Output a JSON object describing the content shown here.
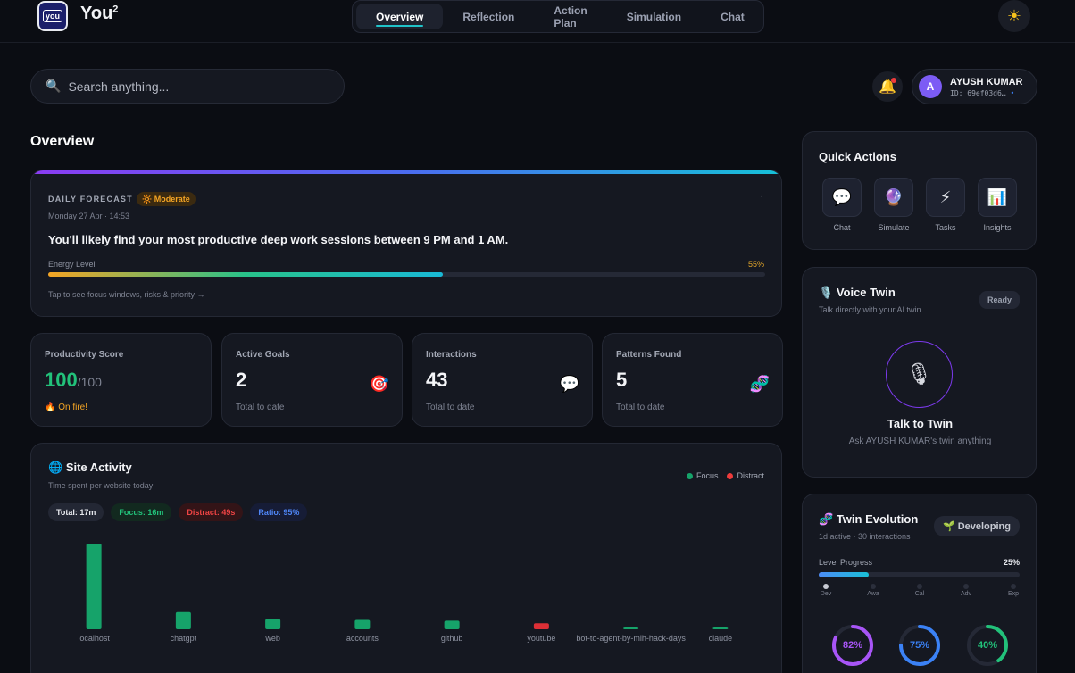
{
  "header": {
    "logo_text": "you",
    "brand_name": "You",
    "brand_sup": "2",
    "tabs": [
      {
        "label": "Overview",
        "active": true
      },
      {
        "label": "Reflection",
        "active": false
      },
      {
        "label": "Action Plan",
        "active": false
      },
      {
        "label": "Simulation",
        "active": false
      },
      {
        "label": "Chat",
        "active": false
      }
    ],
    "theme_icon": "sun-icon"
  },
  "search": {
    "placeholder": "Search anything..."
  },
  "user": {
    "initial": "A",
    "name": "AYUSH KUMAR",
    "id": "ID: 69ef03d6…",
    "status_dot": "•"
  },
  "page_title": "Overview",
  "forecast": {
    "label": "DAILY FORECAST",
    "badge": "🔆 Moderate",
    "date": "Monday 27 Apr · 14:53",
    "menu_dot": "·",
    "text": "You'll likely find your most productive deep work sessions between 9 PM and 1 AM.",
    "energy_label": "Energy Level",
    "energy_pct_label": "55%",
    "energy_value": 0.55,
    "hint": "Tap to see focus windows, risks & priority →"
  },
  "stats": [
    {
      "title": "Productivity Score",
      "value": "100",
      "suffix": "/100",
      "sub": "🔥 On fire!",
      "icon": ""
    },
    {
      "title": "Active Goals",
      "value": "2",
      "suffix": "",
      "sub": "Total to date",
      "icon": "🎯"
    },
    {
      "title": "Interactions",
      "value": "43",
      "suffix": "",
      "sub": "Total to date",
      "icon": "💬"
    },
    {
      "title": "Patterns Found",
      "value": "5",
      "suffix": "",
      "sub": "Total to date",
      "icon": "🧬"
    }
  ],
  "site_activity": {
    "icon": "🌐",
    "title": "Site Activity",
    "subtitle": "Time spent per website today",
    "legend_focus": "Focus",
    "legend_distract": "Distract",
    "pills": {
      "total": "Total: 17m",
      "focus": "Focus: 16m",
      "distract": "Distract: 49s",
      "ratio": "Ratio: 95%"
    }
  },
  "chart_data": {
    "type": "bar",
    "categories": [
      "localhost",
      "chatgpt",
      "web",
      "accounts",
      "github",
      "youtube",
      "bot-to-agent-by-mlh-hack-days",
      "claude"
    ],
    "values": [
      100,
      20,
      12,
      11,
      10,
      7,
      2,
      2
    ],
    "kinds": [
      "focus",
      "focus",
      "focus",
      "focus",
      "focus",
      "distract",
      "focus",
      "focus"
    ],
    "series": [
      {
        "name": "Focus"
      },
      {
        "name": "Distract"
      }
    ],
    "colors": {
      "focus": "#16a36a",
      "distract": "#dc2f36"
    },
    "legend": "top-right",
    "grid": false
  },
  "quick_actions": {
    "title": "Quick Actions",
    "items": [
      {
        "label": "Chat",
        "icon": "💬"
      },
      {
        "label": "Simulate",
        "icon": "🔮"
      },
      {
        "label": "Tasks",
        "icon": "⚡"
      },
      {
        "label": "Insights",
        "icon": "📊"
      }
    ]
  },
  "voice_twin": {
    "icon": "🎙️",
    "title": "Voice Twin",
    "subtitle": "Talk directly with your AI twin",
    "status": "Ready",
    "cta": "Talk to Twin",
    "cta_sub": "Ask AYUSH KUMAR's twin anything"
  },
  "twin_evolution": {
    "icon": "🧬",
    "title": "Twin Evolution",
    "subtitle": "1d active · 30 interactions",
    "badge_icon": "🌱",
    "badge": "Developing",
    "level_label": "Level Progress",
    "level_pct_label": "25%",
    "level_value": 0.25,
    "stages": [
      "Dev",
      "Awa",
      "Cal",
      "Adv",
      "Exp"
    ],
    "current_stage": 0,
    "rings": [
      {
        "label": "82%",
        "value": 0.82,
        "color": "#a855f7"
      },
      {
        "label": "75%",
        "value": 0.75,
        "color": "#3b82f6"
      },
      {
        "label": "40%",
        "value": 0.4,
        "color": "#22c17a"
      }
    ]
  }
}
